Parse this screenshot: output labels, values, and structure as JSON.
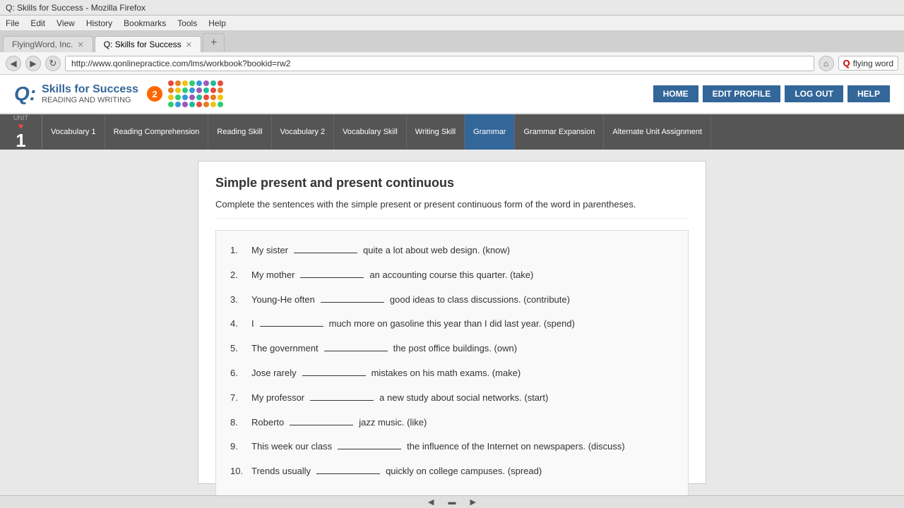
{
  "browser": {
    "title": "Q: Skills for Success - Mozilla Firefox",
    "menu_items": [
      "File",
      "Edit",
      "View",
      "History",
      "Bookmarks",
      "Tools",
      "Help"
    ],
    "tabs": [
      {
        "label": "FlyingWord, Inc.",
        "active": false
      },
      {
        "label": "Q: Skills for Success",
        "active": true
      }
    ],
    "address": "http://www.qonlinepractice.com/lms/workbook?bookid=rw2",
    "search_text": "flying word"
  },
  "header": {
    "logo_q": "Q:",
    "logo_title": "Skills for Success",
    "logo_subtitle": "READING AND WRITING",
    "logo_badge": "2",
    "nav_buttons": [
      "HOME",
      "EDIT PROFILE",
      "LOG OUT",
      "HELP"
    ]
  },
  "unit_nav": {
    "unit_label": "UNIT",
    "unit_number": "1",
    "tabs": [
      {
        "label": "Vocabulary 1",
        "active": false
      },
      {
        "label": "Reading Comprehension",
        "active": false
      },
      {
        "label": "Reading Skill",
        "active": false
      },
      {
        "label": "Vocabulary 2",
        "active": false
      },
      {
        "label": "Vocabulary Skill",
        "active": false
      },
      {
        "label": "Writing Skill",
        "active": false
      },
      {
        "label": "Grammar",
        "active": true
      },
      {
        "label": "Grammar Expansion",
        "active": false
      },
      {
        "label": "Alternate Unit Assignment",
        "active": false
      }
    ]
  },
  "exercise": {
    "title": "Simple present and present continuous",
    "instructions": "Complete the sentences with the simple present or present continuous form of the word in parentheses.",
    "sentences": [
      {
        "num": "1.",
        "pre": "My sister",
        "blank_width": 90,
        "post": "quite a lot about web design. (know)"
      },
      {
        "num": "2.",
        "pre": "My mother",
        "blank_width": 90,
        "post": "an accounting course this quarter. (take)"
      },
      {
        "num": "3.",
        "pre": "Young-He often",
        "blank_width": 90,
        "post": "good ideas to class discussions. (contribute)"
      },
      {
        "num": "4.",
        "pre": "I",
        "blank_width": 90,
        "post": "much more on gasoline this year than I did last year. (spend)"
      },
      {
        "num": "5.",
        "pre": "The government",
        "blank_width": 90,
        "post": "the post office buildings. (own)"
      },
      {
        "num": "6.",
        "pre": "Jose rarely",
        "blank_width": 90,
        "post": "mistakes on his math exams. (make)"
      },
      {
        "num": "7.",
        "pre": "My professor",
        "blank_width": 90,
        "post": "a new study about social networks. (start)"
      },
      {
        "num": "8.",
        "pre": "Roberto",
        "blank_width": 90,
        "post": "jazz music. (like)"
      },
      {
        "num": "9.",
        "pre": "This week our class",
        "blank_width": 90,
        "post": "the influence of the Internet on newspapers. (discuss)"
      },
      {
        "num": "10.",
        "pre": "Trends usually",
        "blank_width": 90,
        "post": "quickly on college campuses. (spread)"
      }
    ]
  },
  "dots_colors": [
    "#e74c3c",
    "#e67e22",
    "#f1c40f",
    "#2ecc71",
    "#3498db",
    "#9b59b6",
    "#1abc9c",
    "#e74c3c",
    "#e67e22",
    "#f1c40f",
    "#2ecc71",
    "#3498db",
    "#9b59b6",
    "#1abc9c",
    "#e74c3c",
    "#e67e22",
    "#f1c40f",
    "#2ecc71",
    "#3498db",
    "#9b59b6",
    "#1abc9c",
    "#e74c3c",
    "#e67e22",
    "#f1c40f",
    "#2ecc71",
    "#3498db",
    "#9b59b6",
    "#1abc9c",
    "#e74c3c",
    "#e67e22",
    "#f1c40f",
    "#2ecc71"
  ]
}
